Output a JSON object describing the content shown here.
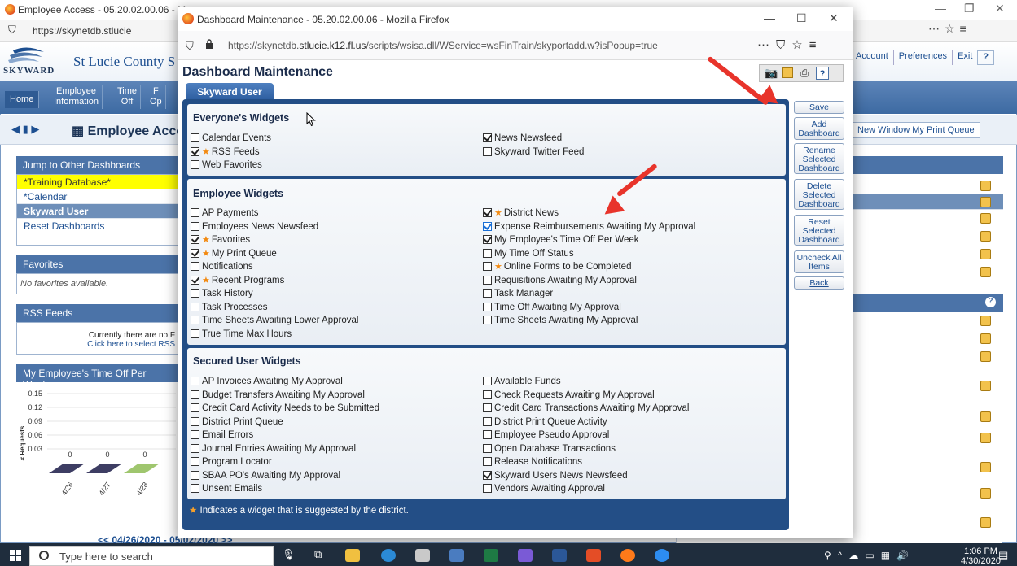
{
  "bg": {
    "window_title": "Employee Access - 05.20.02.00.06 - Mo",
    "url": "https://skynetdb.stlucie",
    "logo_text": "SKYWARD",
    "district": "St Lucie County S",
    "links": [
      "Account",
      "Preferences",
      "Exit",
      "?"
    ],
    "nav": [
      {
        "label": "Home"
      },
      {
        "label": "Employee\nInformation"
      },
      {
        "label": "Time\nOff"
      },
      {
        "label": "F\nOp"
      }
    ],
    "page_title": "Employee Acces",
    "toolbar_right": "New Window   My Print Queue",
    "jump_header": "Jump to Other Dashboards",
    "jump_items": [
      "*Training Database*",
      "*Calendar",
      "Skyward User",
      "Reset Dashboards"
    ],
    "favorites_header": "Favorites",
    "favorites_empty": "No favorites available.",
    "rss_header": "RSS Feeds",
    "rss_line1": "Currently there are no F",
    "rss_line2": "Click here to select RSS",
    "timeoff_header": "My Employee's Time Off Per Week",
    "chart_nav": "<< 04/26/2020 - 05/02/2020 >>"
  },
  "chart_data": {
    "type": "bar",
    "ylabel": "# Requests",
    "y_ticks": [
      "0.15",
      "0.12",
      "0.09",
      "0.06",
      "0.03"
    ],
    "categories": [
      "4/26",
      "4/27",
      "4/28"
    ],
    "values": [
      0,
      0,
      0
    ],
    "value_labels": [
      "0",
      "0",
      "0"
    ]
  },
  "popup": {
    "window_title": "Dashboard Maintenance - 05.20.02.00.06 - Mozilla Firefox",
    "url_prefix": "https://skynetdb.",
    "url_domain": "stlucie.k12.fl.us",
    "url_path": "/scripts/wsisa.dll/WService=wsFinTrain/skyportadd.w?isPopup=true",
    "heading": "Dashboard Maintenance",
    "tab": "Skyward User",
    "legend": "Indicates a widget that is suggested by the district.",
    "buttons": {
      "save": "Save",
      "add": "Add Dashboard",
      "rename": "Rename Selected Dashboard",
      "delete": "Delete Selected Dashboard",
      "reset": "Reset Selected Dashboard",
      "uncheck": "Uncheck All Items",
      "back": "Back"
    },
    "sections": {
      "everyone": {
        "title": "Everyone's Widgets",
        "left": [
          {
            "label": "Calendar Events",
            "checked": false,
            "star": false
          },
          {
            "label": "RSS Feeds",
            "checked": true,
            "star": true
          },
          {
            "label": "Web Favorites",
            "checked": false,
            "star": false
          }
        ],
        "right": [
          {
            "label": "News Newsfeed",
            "checked": true,
            "star": false
          },
          {
            "label": "Skyward Twitter Feed",
            "checked": false,
            "star": false
          }
        ]
      },
      "employee": {
        "title": "Employee Widgets",
        "left": [
          {
            "label": "AP Payments",
            "checked": false,
            "star": false
          },
          {
            "label": "Employees News Newsfeed",
            "checked": false,
            "star": false
          },
          {
            "label": "Favorites",
            "checked": true,
            "star": true
          },
          {
            "label": "My Print Queue",
            "checked": true,
            "star": true
          },
          {
            "label": "Notifications",
            "checked": false,
            "star": false
          },
          {
            "label": "Recent Programs",
            "checked": true,
            "star": true
          },
          {
            "label": "Task History",
            "checked": false,
            "star": false
          },
          {
            "label": "Task Processes",
            "checked": false,
            "star": false
          },
          {
            "label": "Time Sheets Awaiting Lower Approval",
            "checked": false,
            "star": false
          },
          {
            "label": "True Time Max Hours",
            "checked": false,
            "star": false
          }
        ],
        "right": [
          {
            "label": "District News",
            "checked": true,
            "star": true
          },
          {
            "label": "Expense Reimbursements Awaiting My Approval",
            "checked": true,
            "star": false,
            "focus": true
          },
          {
            "label": "My Employee's Time Off Per Week",
            "checked": true,
            "star": false
          },
          {
            "label": "My Time Off Status",
            "checked": false,
            "star": false
          },
          {
            "label": "Online Forms to be Completed",
            "checked": false,
            "star": true
          },
          {
            "label": "Requisitions Awaiting My Approval",
            "checked": false,
            "star": false
          },
          {
            "label": "Task Manager",
            "checked": false,
            "star": false
          },
          {
            "label": "Time Off Awaiting My Approval",
            "checked": false,
            "star": false
          },
          {
            "label": "Time Sheets Awaiting My Approval",
            "checked": false,
            "star": false
          }
        ]
      },
      "secured": {
        "title": "Secured User Widgets",
        "left": [
          {
            "label": "AP Invoices Awaiting My Approval",
            "checked": false,
            "star": false
          },
          {
            "label": "Budget Transfers Awaiting My Approval",
            "checked": false,
            "star": false
          },
          {
            "label": "Credit Card Activity Needs to be Submitted",
            "checked": false,
            "star": false
          },
          {
            "label": "District Print Queue",
            "checked": false,
            "star": false
          },
          {
            "label": "Email Errors",
            "checked": false,
            "star": false
          },
          {
            "label": "Journal Entries Awaiting My Approval",
            "checked": false,
            "star": false
          },
          {
            "label": "Program Locator",
            "checked": false,
            "star": false
          },
          {
            "label": "SBAA PO's Awaiting My Approval",
            "checked": false,
            "star": false
          },
          {
            "label": "Unsent Emails",
            "checked": false,
            "star": false
          }
        ],
        "right": [
          {
            "label": "Available Funds",
            "checked": false,
            "star": false
          },
          {
            "label": "Check Requests Awaiting My Approval",
            "checked": false,
            "star": false
          },
          {
            "label": "Credit Card Transactions Awaiting My Approval",
            "checked": false,
            "star": false
          },
          {
            "label": "District Print Queue Activity",
            "checked": false,
            "star": false
          },
          {
            "label": "Employee Pseudo Approval",
            "checked": false,
            "star": false
          },
          {
            "label": "Open Database Transactions",
            "checked": false,
            "star": false
          },
          {
            "label": "Release Notifications",
            "checked": false,
            "star": false
          },
          {
            "label": "Skyward Users News Newsfeed",
            "checked": true,
            "star": false
          },
          {
            "label": "Vendors Awaiting Approval",
            "checked": false,
            "star": false
          }
        ]
      }
    }
  },
  "taskbar": {
    "search_placeholder": "Type here to search",
    "time": "1:06 PM",
    "date": "4/30/2020"
  },
  "colors": {
    "accent": "#234e86",
    "star": "#f28a12",
    "arrow": "#e8342b"
  }
}
